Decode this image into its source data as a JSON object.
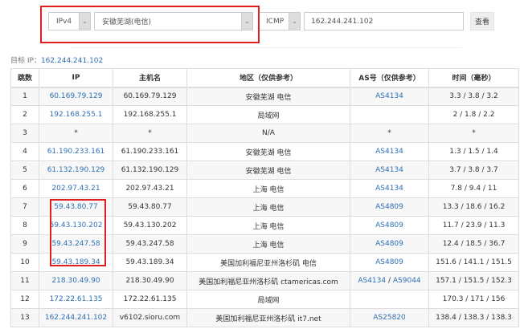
{
  "controls": {
    "ip_version": "IPv4",
    "node": "安徽芜湖(电信)",
    "protocol": "ICMP",
    "target_input": "162.244.241.102",
    "submit_label": "查看"
  },
  "target": {
    "label": "目标 IP：",
    "ip": "162.244.241.102"
  },
  "table": {
    "headers": [
      "跳数",
      "IP",
      "主机名",
      "地区（仅供参考）",
      "AS号（仅供参考）",
      "时间（毫秒）"
    ],
    "rows": [
      {
        "hop": "1",
        "ip": "60.169.79.129",
        "host": "60.169.79.129",
        "region": "安徽芜湖 电信",
        "as": [
          "AS4134"
        ],
        "time": "3.3 / 3.8 / 3.2"
      },
      {
        "hop": "2",
        "ip": "192.168.255.1",
        "host": "192.168.255.1",
        "region": "局域网",
        "as": [],
        "time": "2 / 1.8 / 2.2"
      },
      {
        "hop": "3",
        "ip": "*",
        "host": "*",
        "region": "N/A",
        "as": [
          "*"
        ],
        "time": "*"
      },
      {
        "hop": "4",
        "ip": "61.190.233.161",
        "host": "61.190.233.161",
        "region": "安徽芜湖 电信",
        "as": [
          "AS4134"
        ],
        "time": "1.3 / 1.5 / 1.4"
      },
      {
        "hop": "5",
        "ip": "61.132.190.129",
        "host": "61.132.190.129",
        "region": "安徽芜湖 电信",
        "as": [
          "AS4134"
        ],
        "time": "3.7 / 3.8 / 3.7"
      },
      {
        "hop": "6",
        "ip": "202.97.43.21",
        "host": "202.97.43.21",
        "region": "上海 电信",
        "as": [
          "AS4134"
        ],
        "time": "7.8 / 9.4 / 11"
      },
      {
        "hop": "7",
        "ip": "59.43.80.77",
        "host": "59.43.80.77",
        "region": "上海 电信",
        "as": [
          "AS4809"
        ],
        "time": "13.3 / 18.6 / 16.2"
      },
      {
        "hop": "8",
        "ip": "59.43.130.202",
        "host": "59.43.130.202",
        "region": "上海 电信",
        "as": [
          "AS4809"
        ],
        "time": "11.7 / 23.9 / 11.3"
      },
      {
        "hop": "9",
        "ip": "59.43.247.58",
        "host": "59.43.247.58",
        "region": "上海 电信",
        "as": [
          "AS4809"
        ],
        "time": "12.4 / 18.5 / 36.7"
      },
      {
        "hop": "10",
        "ip": "59.43.189.34",
        "host": "59.43.189.34",
        "region": "美国加利福尼亚州洛杉矶 电信",
        "as": [
          "AS4809"
        ],
        "time": "151.6 / 141.1 / 151.5"
      },
      {
        "hop": "11",
        "ip": "218.30.49.90",
        "host": "218.30.49.90",
        "region": "美国加利福尼亚州洛杉矶 ctamericas.com",
        "as": [
          "AS4134",
          "AS9044"
        ],
        "time": "157.1 / 151.5 / 152.3"
      },
      {
        "hop": "12",
        "ip": "172.22.61.135",
        "host": "172.22.61.135",
        "region": "局域网",
        "as": [],
        "time": "170.3 / 171 / 156"
      },
      {
        "hop": "13",
        "ip": "162.244.241.102",
        "host": "v6102.sioru.com",
        "region": "美国加利福尼亚州洛杉矶 it7.net",
        "as": [
          "AS25820"
        ],
        "time": "138.4 / 138.3 / 138.3"
      }
    ]
  },
  "colors": {
    "link": "#2f6fb5",
    "highlight_box": "#e02020"
  }
}
